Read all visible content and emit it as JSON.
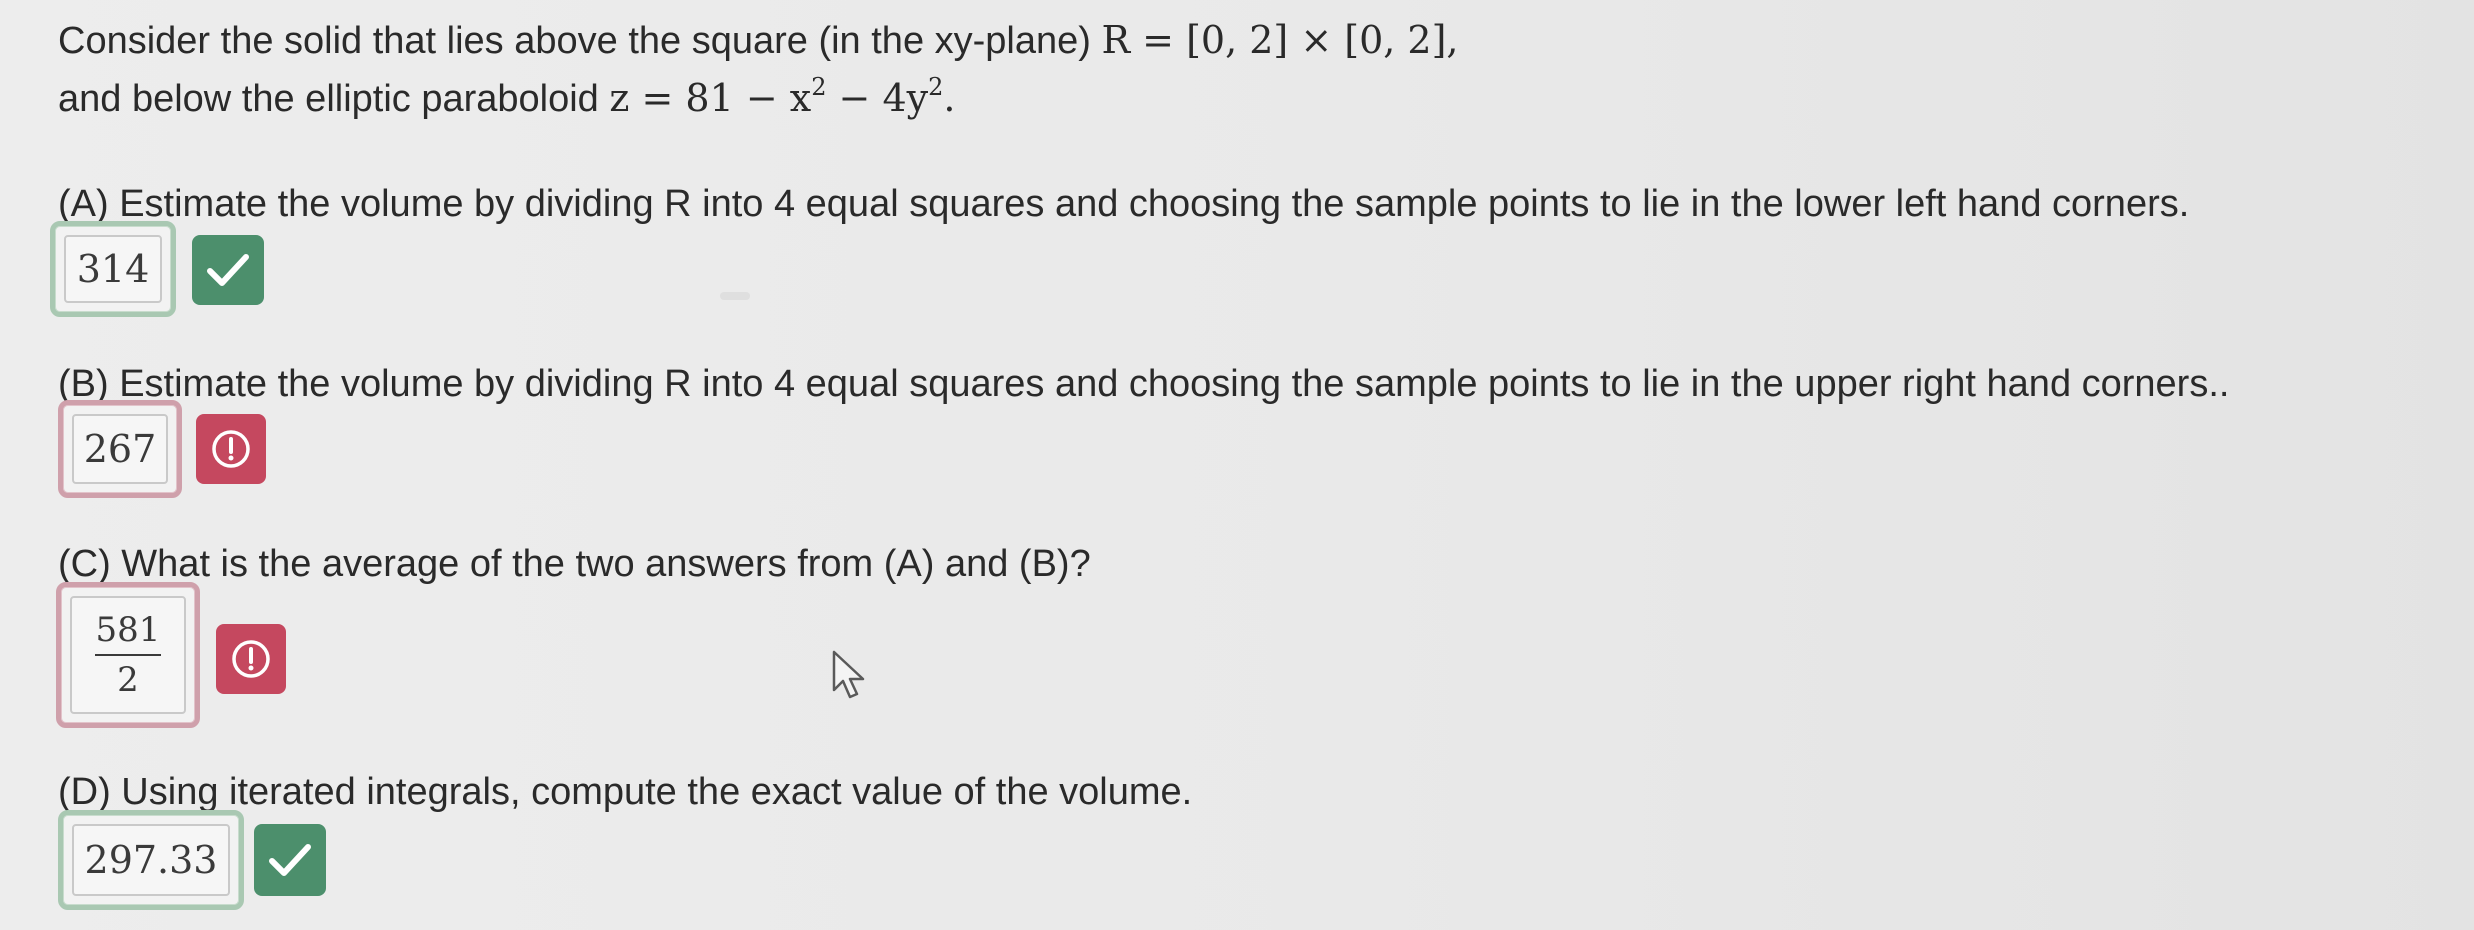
{
  "problem": {
    "intro_prefix": "Consider the solid that lies above the square (in the xy-plane) ",
    "region_math": "R = [0, 2] × [0, 2],",
    "line2_prefix": "and below the elliptic paraboloid ",
    "surface_math_lhs": "z = 81 − x",
    "surface_math_mid": " − 4y",
    "surface_math_end": ".",
    "exp": "2"
  },
  "parts": {
    "a": {
      "prompt": "(A) Estimate the volume by dividing R into 4 equal squares and choosing the sample points to lie in the lower left hand corners.",
      "answer": "314",
      "status": "correct"
    },
    "b": {
      "prompt": "(B) Estimate the volume by dividing R into 4 equal squares and choosing the sample points to lie in the upper right hand corners..",
      "answer": "267",
      "status": "incorrect"
    },
    "c": {
      "prompt": "(C) What is the average of the two answers from (A) and (B)?",
      "answer_numerator": "581",
      "answer_denominator": "2",
      "status": "incorrect"
    },
    "d": {
      "prompt": "(D) Using iterated integrals, compute the exact value of the volume.",
      "answer": "297.33",
      "status": "correct"
    }
  },
  "icons": {
    "correct": "checkmark-icon",
    "incorrect": "exclamation-circle-icon",
    "pointer": "mouse-pointer-icon"
  },
  "colors": {
    "correct_badge": "#4c8f6c",
    "incorrect_badge": "#c5485f",
    "correct_ring": "#a9c8b2",
    "incorrect_ring": "#cfa0ab"
  }
}
